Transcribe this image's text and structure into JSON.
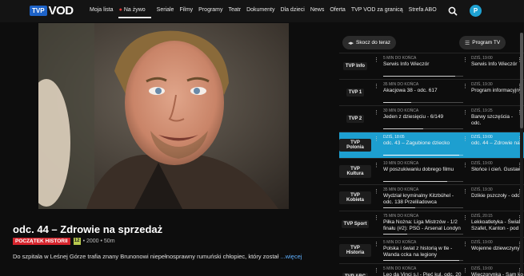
{
  "nav": {
    "logo_tvp": "TVP",
    "logo_vod": "VOD",
    "items": [
      "Moja lista",
      "Na żywo",
      "Seriale",
      "Filmy",
      "Programy",
      "Teatr",
      "Dokumenty",
      "Dla dzieci",
      "News",
      "Oferta",
      "TVP VOD za granicą",
      "Strefa ABO"
    ],
    "avatar_letter": "P",
    "live_dot": "●"
  },
  "program": {
    "title": "odc. 44 – Zdrowie na sprzedaż",
    "badge": "POCZĄTEK HISTORII",
    "age": "12",
    "meta": "• 2000 • 50m",
    "description": "Do szpitala w Leśnej Górze trafia znany Brunonowi niepełnosprawny rumuński chłopiec, który został",
    "more": "...więcej"
  },
  "panel": {
    "jump_label": "Skocz do teraz",
    "jump_icon": "◂▸",
    "guide_label": "Program TV",
    "guide_icon": "☰"
  },
  "channels": [
    {
      "logo": "TVP Info",
      "now_time": "5 MIN DO KOŃCA",
      "now_title": "Serwis Info Wieczór",
      "now_progress": 0.9,
      "next_time": "DZIŚ, 19:00",
      "next_title": "Serwis Info Wieczór"
    },
    {
      "logo": "TVP 1",
      "now_time": "35 MIN DO KOŃCA",
      "now_title": "Akacjowa 38 - odc. 617",
      "now_progress": 0.35,
      "next_time": "DZIŚ, 19:30",
      "next_title": "Program informacyjny"
    },
    {
      "logo": "TVP 2",
      "now_time": "30 MIN DO KOŃCA",
      "now_title": "Jeden z dziesięciu - 6/149",
      "now_progress": 0.5,
      "next_time": "DZIŚ, 19:25",
      "next_title": "Barwy szczęścia - odc."
    },
    {
      "logo": "TVP Polonia",
      "now_time": "DZIŚ, 18:05",
      "now_title": "odc. 43 – Zagubione dziecko",
      "now_progress": 0.95,
      "next_time": "DZIŚ, 19:00",
      "next_title": "odc. 44 – Zdrowie na",
      "active": true
    },
    {
      "logo": "TVP Kultura",
      "now_time": "10 MIN DO KOŃCA",
      "now_title": "W poszukiwaniu dobrego filmu",
      "now_progress": 0.8,
      "next_time": "DZIŚ, 19:00",
      "next_title": "Słońce i cień. Gustaw"
    },
    {
      "logo": "TVP Kobieta",
      "now_time": "35 MIN DO KOŃCA",
      "now_title": "Wydział kryminalny Kitzbühel - odc. 138 Przeliladowca",
      "now_progress": 0.4,
      "next_time": "DZIŚ, 19:30",
      "next_title": "Dzikie pszczoły - odc."
    },
    {
      "logo": "TVP Sport",
      "now_time": "75 MIN DO KOŃCA",
      "now_title": "Piłka Nożna: Liga Mistrzów - 1/2 finału (#2): PSG - Arsenal Londyn",
      "now_progress": 0.3,
      "next_time": "DZIŚ, 20:15",
      "next_title": "Lekkoatletyka - Świat Szafet, Kanton - pod"
    },
    {
      "logo": "TVP Historia",
      "now_time": "5 MIN DO KOŃCA",
      "now_title": "Polska i świat z historią w tle - Wanda ccka na legiony",
      "now_progress": 0.95,
      "next_time": "DZIŚ, 19:00",
      "next_title": "Wojenne dziewczyny"
    },
    {
      "logo": "TVP ABC",
      "now_time": "5 MIN DO KOŃCA",
      "now_title": "Leo da Vinci s.l - Pięć kul, odc. 20",
      "now_progress": 0.95,
      "next_time": "DZIŚ, 19:00",
      "next_title": "Wieczorynka - Sam ko"
    }
  ],
  "colors": {
    "accent": "#1d9fd0",
    "badge_red": "#d6252d",
    "link": "#5fb0ff"
  }
}
